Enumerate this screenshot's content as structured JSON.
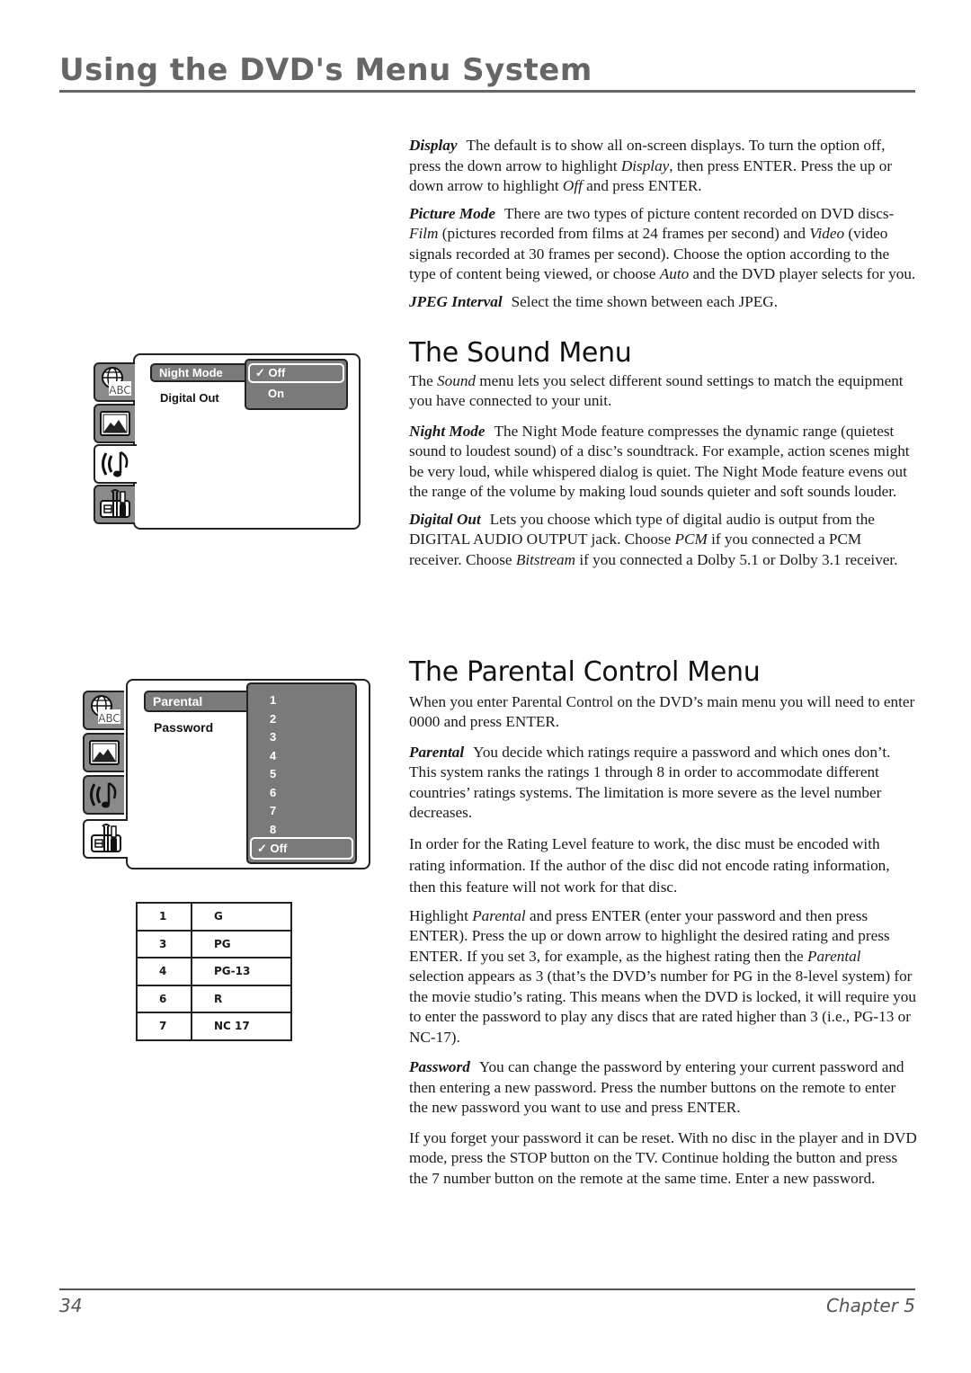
{
  "header": {
    "title": "Using the DVD's Menu System"
  },
  "display_section": {
    "display": {
      "term": "Display",
      "text_parts": [
        "The default is to show all on-screen displays. To turn the option off, press the down arrow to highlight ",
        "Display",
        ", then press ENTER. Press the up or down arrow to highlight ",
        "Off",
        " and press ENTER."
      ]
    },
    "picture_mode": {
      "term": "Picture Mode",
      "text_parts": [
        "There are two types of picture content recorded on DVD discs- ",
        "Film",
        " (pictures recorded from films at 24 frames per second) and ",
        "Video",
        " (video signals recorded at 30 frames per second). Choose the option according to the type of content being viewed, or choose ",
        "Auto",
        " and the DVD player selects for you."
      ]
    },
    "jpeg_interval": {
      "term": "JPEG Interval",
      "text": "Select the time shown between each JPEG."
    }
  },
  "sound_menu": {
    "heading": "The Sound Menu",
    "intro_parts": [
      "The ",
      "Sound",
      " menu lets you select different sound settings to match the equipment you have connected to your unit."
    ],
    "night_mode": {
      "term": "Night Mode",
      "text": "The Night Mode feature compresses the dynamic range (quietest sound to loudest sound) of a disc’s soundtrack. For example, action scenes might be very loud, while whispered dialog is quiet. The Night Mode feature evens out the range of the volume by making loud sounds quieter and soft sounds louder."
    },
    "digital_out": {
      "term": "Digital Out",
      "text_parts": [
        "Lets you choose which type of digital audio is output from the DIGITAL AUDIO OUTPUT jack. Choose ",
        "PCM",
        " if you connected a PCM receiver. Choose ",
        "Bitstream",
        " if you connected a Dolby 5.1 or Dolby 3.1 receiver."
      ]
    }
  },
  "sound_screen": {
    "tabs": [
      "language-abc-icon",
      "picture-icon",
      "sound-icon",
      "setup-tools-icon"
    ],
    "active_tab": 2,
    "items": [
      "Night Mode",
      "Digital Out"
    ],
    "highlighted_item": "Night Mode",
    "options": [
      "Off",
      "On"
    ],
    "selected_option": "Off",
    "check": "✓"
  },
  "parental_menu": {
    "heading": "The Parental Control Menu",
    "intro": "When you enter Parental Control on the DVD’s main menu you will need to enter 0000 and press ENTER.",
    "parental": {
      "term": "Parental",
      "text": "You decide which ratings require a password and which ones don’t. This system ranks the ratings 1 through 8 in order to accommodate different countries’ ratings systems. The limitation is more severe as the level number decreases."
    },
    "rating_level": "In order for the Rating Level feature to work, the disc must be encoded with rating information. If the author of the disc did not encode rating information, then this feature will not work for that disc.",
    "highlight_parts": [
      "Highlight ",
      "Parental",
      " and press ENTER (enter your password and then press ENTER). Press the up or down arrow to highlight the desired rating and press ENTER. If you set 3, for example, as the highest rating then the ",
      "Parental",
      " selection appears as 3 (that’s the DVD’s number for PG in the 8-level system) for the movie studio’s rating. This means when the DVD is locked, it will require you to enter the password to play any discs that are rated higher than 3 (i.e., PG-13 or NC-17)."
    ],
    "password": {
      "term": "Password",
      "text": "You can change the password by entering your current password and then entering a new password. Press the number buttons on the remote to enter the new password you want to use and press ENTER."
    },
    "reset": "If you forget your password it can be reset. With no disc in the player and in DVD mode, press the STOP button on the TV. Continue holding the button and press the 7 number button on the remote at the same time. Enter a new password."
  },
  "parental_screen": {
    "tabs": [
      "language-abc-icon",
      "picture-icon",
      "sound-icon",
      "setup-tools-icon"
    ],
    "active_tab": 3,
    "items": [
      "Parental",
      "Password"
    ],
    "highlighted_item": "Parental",
    "options": [
      "1",
      "2",
      "3",
      "4",
      "5",
      "6",
      "7",
      "8",
      "Off"
    ],
    "selected_option": "Off",
    "check": "✓"
  },
  "rating_table": {
    "rows": [
      {
        "level": "1",
        "rating": "G"
      },
      {
        "level": "3",
        "rating": "PG"
      },
      {
        "level": "4",
        "rating": "PG-13"
      },
      {
        "level": "6",
        "rating": "R"
      },
      {
        "level": "7",
        "rating": "NC 17"
      }
    ]
  },
  "footer": {
    "page_number": "34",
    "chapter": "Chapter 5"
  }
}
